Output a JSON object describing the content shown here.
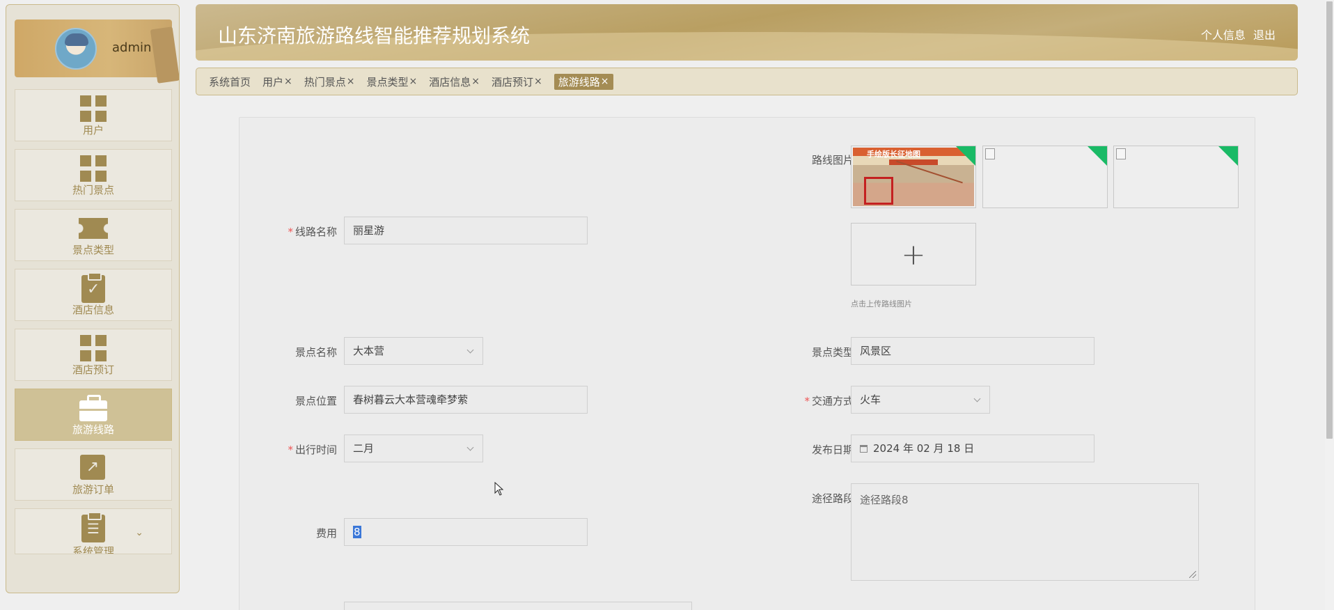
{
  "user": {
    "name": "admin"
  },
  "sidebar": {
    "items": [
      {
        "label": "用户",
        "icon": "grid-icon"
      },
      {
        "label": "热门景点",
        "icon": "grid-icon"
      },
      {
        "label": "景点类型",
        "icon": "ticket-icon"
      },
      {
        "label": "酒店信息",
        "icon": "clipboard-check-icon"
      },
      {
        "label": "酒店预订",
        "icon": "grid-icon"
      },
      {
        "label": "旅游线路",
        "icon": "briefcase-icon",
        "active": true
      },
      {
        "label": "旅游订单",
        "icon": "trend-icon"
      },
      {
        "label": "系统管理",
        "icon": "clipboard-list-icon"
      }
    ]
  },
  "header": {
    "title": "山东济南旅游路线智能推荐规划系统",
    "profile_link": "个人信息",
    "logout_link": "退出"
  },
  "tags": [
    {
      "label": "系统首页",
      "closable": false
    },
    {
      "label": "用户",
      "closable": true
    },
    {
      "label": "热门景点",
      "closable": true
    },
    {
      "label": "景点类型",
      "closable": true
    },
    {
      "label": "酒店信息",
      "closable": true
    },
    {
      "label": "酒店预订",
      "closable": true
    },
    {
      "label": "旅游线路",
      "closable": true,
      "active": true
    }
  ],
  "tag_close_symbol": "×",
  "form": {
    "route_name": {
      "label": "线路名称",
      "value": "丽星游",
      "required": true
    },
    "route_image": {
      "label": "路线图片",
      "hint": "点击上传路线图片",
      "upload_symbol": "+",
      "thumb_title": "手绘版长征地图"
    },
    "spot_name": {
      "label": "景点名称",
      "value": "大本营"
    },
    "spot_type": {
      "label": "景点类型",
      "value": "风景区"
    },
    "spot_location": {
      "label": "景点位置",
      "value": "春树暮云大本营魂牵梦萦"
    },
    "transport": {
      "label": "交通方式",
      "value": "火车",
      "required": true
    },
    "travel_time": {
      "label": "出行时间",
      "value": "二月",
      "required": true
    },
    "publish_date": {
      "label": "发布日期",
      "value": "2024 年 02 月 18 日"
    },
    "waypoints": {
      "label": "途径路段",
      "value": "途径路段8"
    },
    "cost": {
      "label": "费用",
      "value": "8"
    }
  },
  "required_mark": "*",
  "colors": {
    "accent": "#a48c54",
    "sidebar_active": "#cfc196",
    "required": "#ee5555",
    "thumb_corner": "#1aba66"
  }
}
